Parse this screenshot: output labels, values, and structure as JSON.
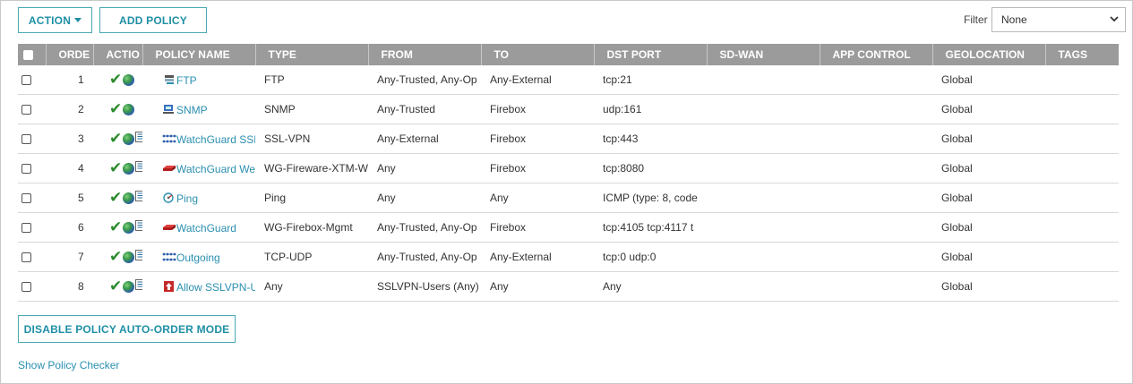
{
  "toolbar": {
    "action_label": "ACTION",
    "add_policy_label": "ADD POLICY"
  },
  "filter": {
    "label": "Filter",
    "selected": "None"
  },
  "table": {
    "headers": [
      "ORDE",
      "ACTIO",
      "POLICY NAME",
      "TYPE",
      "FROM",
      "TO",
      "DST PORT",
      "SD-WAN",
      "APP CONTROL",
      "GEOLOCATION",
      "TAGS"
    ],
    "rows": [
      {
        "order": "1",
        "icons": "check-globe",
        "name_icon": "ftp-icon",
        "name": "FTP",
        "type": "FTP",
        "from": "Any-Trusted, Any-Op",
        "to": "Any-External",
        "dst_port": "tcp:21",
        "sdwan": "",
        "app_control": "",
        "geolocation": "Global",
        "tags": ""
      },
      {
        "order": "2",
        "icons": "check-globe",
        "name_icon": "snmp-icon",
        "name": "SNMP",
        "type": "SNMP",
        "from": "Any-Trusted",
        "to": "Firebox",
        "dst_port": "udp:161",
        "sdwan": "",
        "app_control": "",
        "geolocation": "Global",
        "tags": ""
      },
      {
        "order": "3",
        "icons": "check-globe-log",
        "name_icon": "network-dots-icon",
        "name": "WatchGuard SSL",
        "type": "SSL-VPN",
        "from": "Any-External",
        "to": "Firebox",
        "dst_port": "tcp:443",
        "sdwan": "",
        "app_control": "",
        "geolocation": "Global",
        "tags": ""
      },
      {
        "order": "4",
        "icons": "check-globe-log",
        "name_icon": "firebox-icon",
        "name": "WatchGuard Web",
        "type": "WG-Fireware-XTM-W",
        "from": "Any",
        "to": "Firebox",
        "dst_port": "tcp:8080",
        "sdwan": "",
        "app_control": "",
        "geolocation": "Global",
        "tags": ""
      },
      {
        "order": "5",
        "icons": "check-globe-log",
        "name_icon": "ping-icon",
        "name": "Ping",
        "type": "Ping",
        "from": "Any",
        "to": "Any",
        "dst_port": "ICMP (type: 8, code",
        "sdwan": "",
        "app_control": "",
        "geolocation": "Global",
        "tags": ""
      },
      {
        "order": "6",
        "icons": "check-globe-log",
        "name_icon": "firebox-icon",
        "name": "WatchGuard",
        "type": "WG-Firebox-Mgmt",
        "from": "Any-Trusted, Any-Op",
        "to": "Firebox",
        "dst_port": "tcp:4105 tcp:4117 t",
        "sdwan": "",
        "app_control": "",
        "geolocation": "Global",
        "tags": ""
      },
      {
        "order": "7",
        "icons": "check-globe-log",
        "name_icon": "network-dots-icon",
        "name": "Outgoing",
        "type": "TCP-UDP",
        "from": "Any-Trusted, Any-Op",
        "to": "Any-External",
        "dst_port": "tcp:0 udp:0",
        "sdwan": "",
        "app_control": "",
        "geolocation": "Global",
        "tags": ""
      },
      {
        "order": "8",
        "icons": "check-globe-log",
        "name_icon": "allow-vpn-icon",
        "name": "Allow SSLVPN-Us",
        "type": "Any",
        "from": "SSLVPN-Users (Any)",
        "to": "Any",
        "dst_port": "Any",
        "sdwan": "",
        "app_control": "",
        "geolocation": "Global",
        "tags": ""
      }
    ]
  },
  "footer": {
    "disable_label": "DISABLE POLICY AUTO-ORDER MODE",
    "checker_link": "Show Policy Checker"
  },
  "colors": {
    "accent": "#1f8fa5",
    "header_bg": "#9b9b9b",
    "link": "#2a8fb0",
    "check": "#2c8a2c"
  }
}
